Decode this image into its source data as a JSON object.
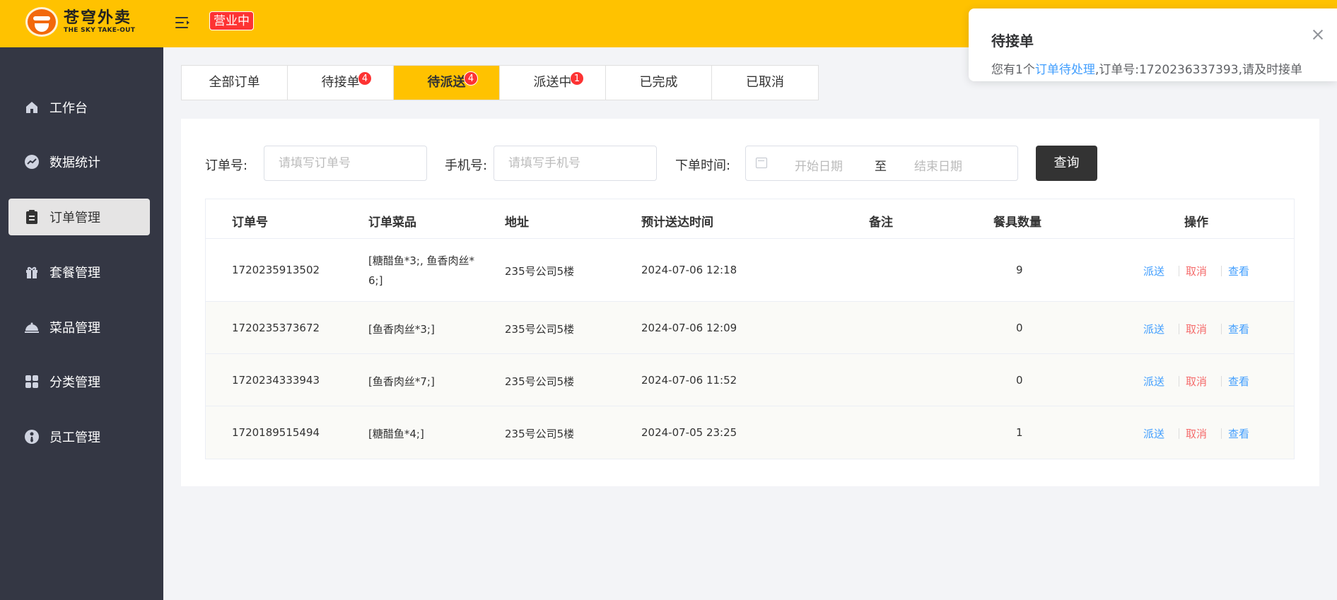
{
  "header": {
    "logo_cn": "苍穹外卖",
    "logo_en": "THE SKY TAKE-OUT",
    "status": "营业中",
    "bg_color": "#ffc200"
  },
  "sidebar": {
    "items": [
      {
        "label": "工作台",
        "icon": "home-icon"
      },
      {
        "label": "数据统计",
        "icon": "chart-icon"
      },
      {
        "label": "订单管理",
        "icon": "clipboard-icon",
        "active": true
      },
      {
        "label": "套餐管理",
        "icon": "gift-icon"
      },
      {
        "label": "菜品管理",
        "icon": "dish-icon"
      },
      {
        "label": "分类管理",
        "icon": "grid-icon"
      },
      {
        "label": "员工管理",
        "icon": "employee-icon"
      }
    ]
  },
  "tabs": [
    {
      "label": "全部订单"
    },
    {
      "label": "待接单",
      "badge": "4"
    },
    {
      "label": "待派送",
      "badge": "4",
      "active": true
    },
    {
      "label": "派送中",
      "badge": "1"
    },
    {
      "label": "已完成"
    },
    {
      "label": "已取消"
    }
  ],
  "filters": {
    "order_label": "订单号:",
    "order_placeholder": "请填写订单号",
    "phone_label": "手机号:",
    "phone_placeholder": "请填写手机号",
    "time_label": "下单时间:",
    "start_placeholder": "开始日期",
    "range_sep": "至",
    "end_placeholder": "结束日期",
    "query_label": "查询"
  },
  "table": {
    "headers": [
      "订单号",
      "订单菜品",
      "地址",
      "预计送达时间",
      "备注",
      "餐具数量",
      "操作"
    ],
    "rows": [
      {
        "order_no": "1720235913502",
        "dishes_1": "[糖醋鱼*3;, 鱼香肉丝*",
        "dishes_2": "6;]",
        "address": "235号公司5楼",
        "eta": "2024-07-06 12:18",
        "remark": "",
        "tableware": "9"
      },
      {
        "order_no": "1720235373672",
        "dishes_1": "[鱼香肉丝*3;]",
        "dishes_2": "",
        "address": "235号公司5楼",
        "eta": "2024-07-06 12:09",
        "remark": "",
        "tableware": "0"
      },
      {
        "order_no": "1720234333943",
        "dishes_1": "[鱼香肉丝*7;]",
        "dishes_2": "",
        "address": "235号公司5楼",
        "eta": "2024-07-06 11:52",
        "remark": "",
        "tableware": "0"
      },
      {
        "order_no": "1720189515494",
        "dishes_1": "[糖醋鱼*4;]",
        "dishes_2": "",
        "address": "235号公司5楼",
        "eta": "2024-07-05 23:25",
        "remark": "",
        "tableware": "1"
      }
    ],
    "actions": {
      "dispatch": "派送",
      "cancel": "取消",
      "view": "查看"
    }
  },
  "notification": {
    "title": "待接单",
    "body_prefix": "您有1个",
    "body_link": "订单待处理",
    "body_suffix": ",订单号:1720236337393,请及时接单"
  }
}
